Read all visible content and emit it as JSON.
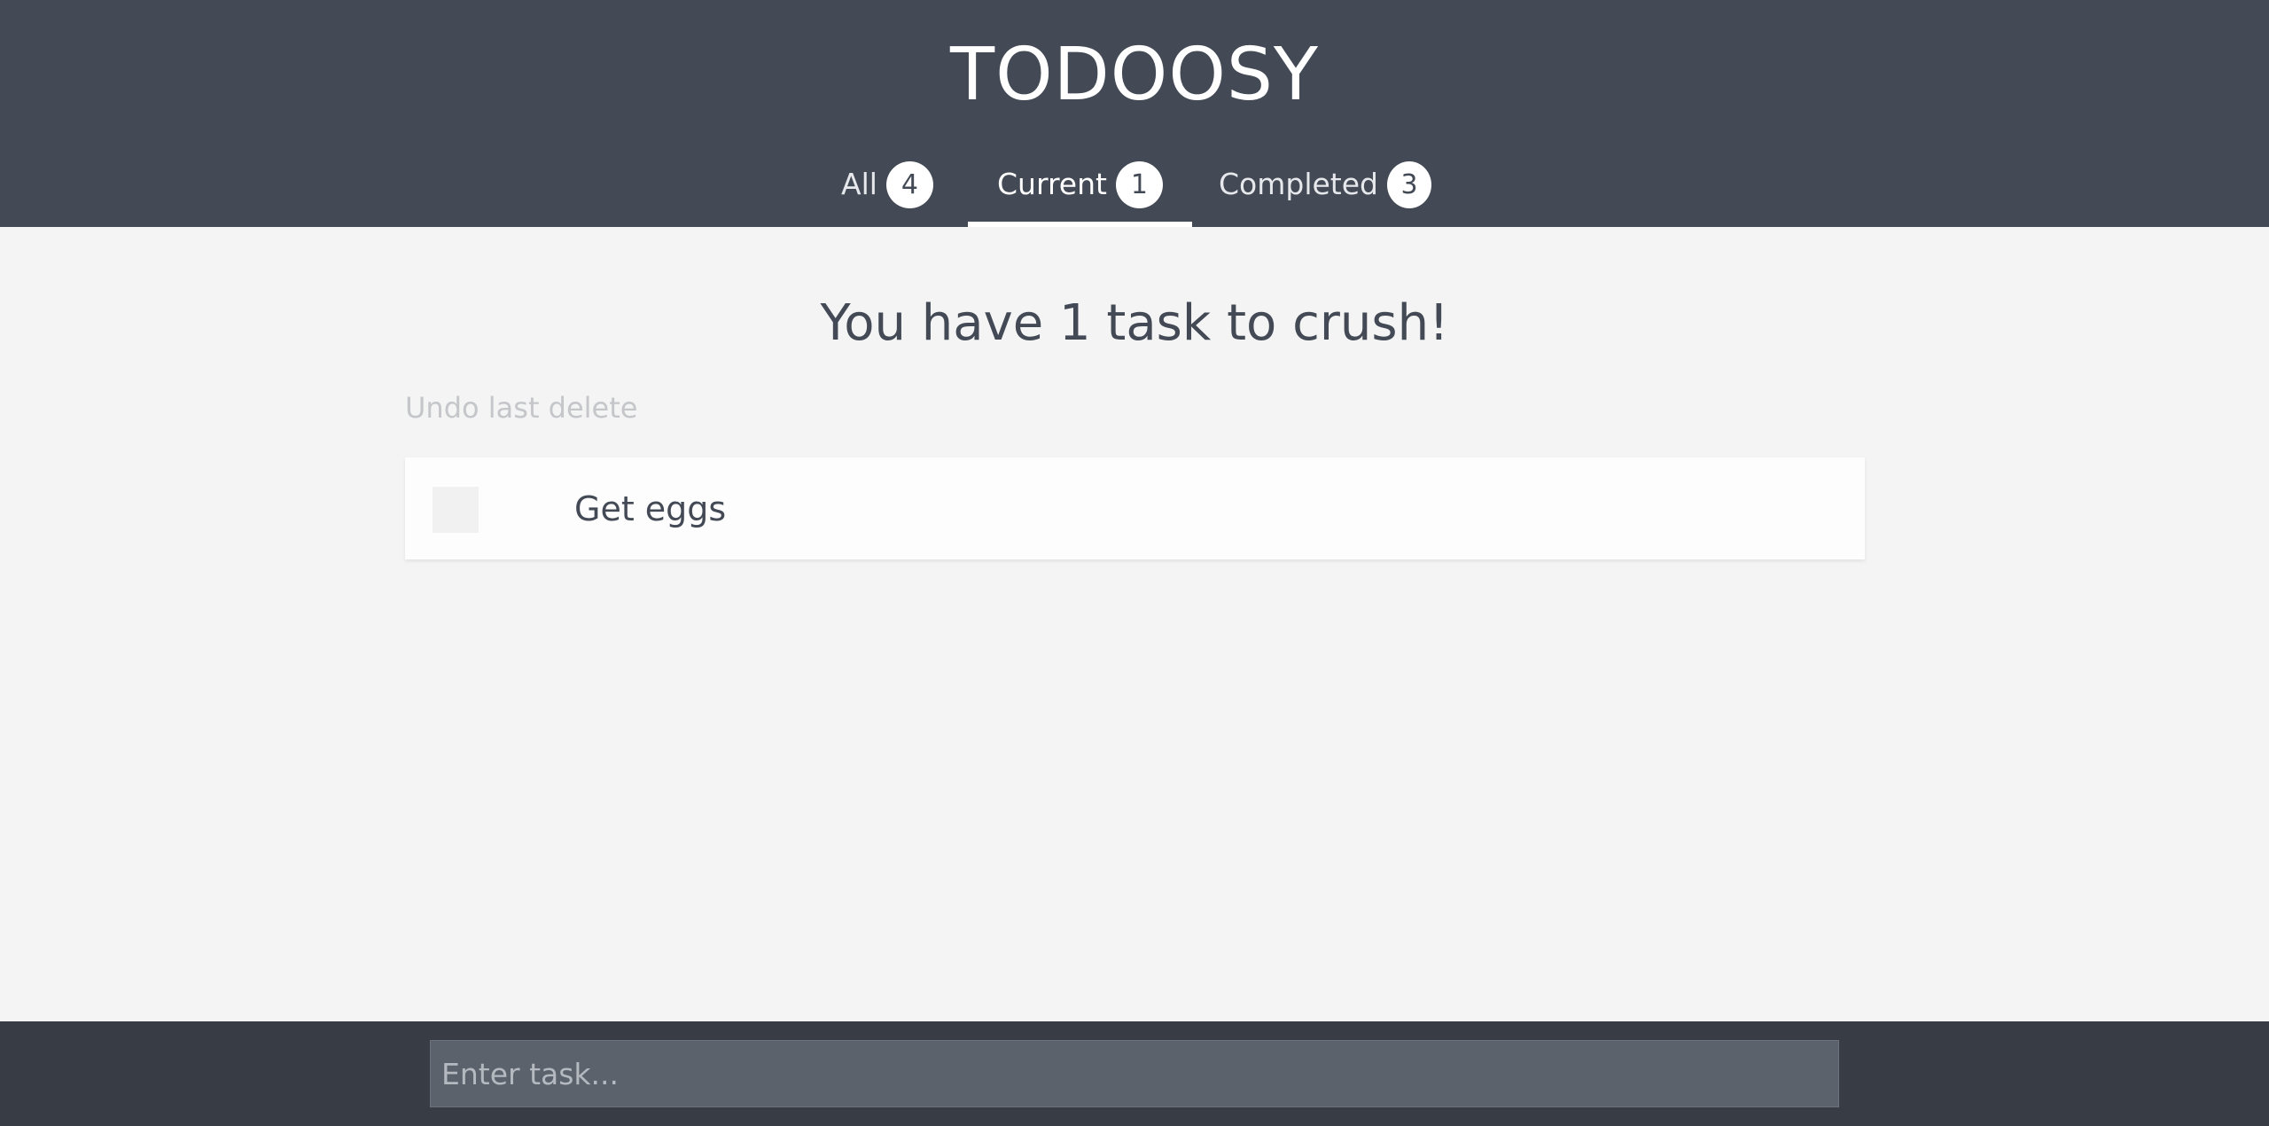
{
  "app": {
    "title": "TODOOSY"
  },
  "tabs": [
    {
      "label": "All",
      "count": "4"
    },
    {
      "label": "Current",
      "count": "1",
      "active": true
    },
    {
      "label": "Completed",
      "count": "3"
    }
  ],
  "main": {
    "summary": "You have 1 task to crush!",
    "undo_label": "Undo last delete",
    "tasks": [
      {
        "text": "Get eggs",
        "completed": false
      }
    ]
  },
  "footer": {
    "input_placeholder": "Enter task...",
    "input_value": ""
  },
  "colors": {
    "header_bg": "#434a55",
    "footer_bg": "#373c45",
    "page_bg": "#f4f4f4",
    "text": "#434a55"
  }
}
